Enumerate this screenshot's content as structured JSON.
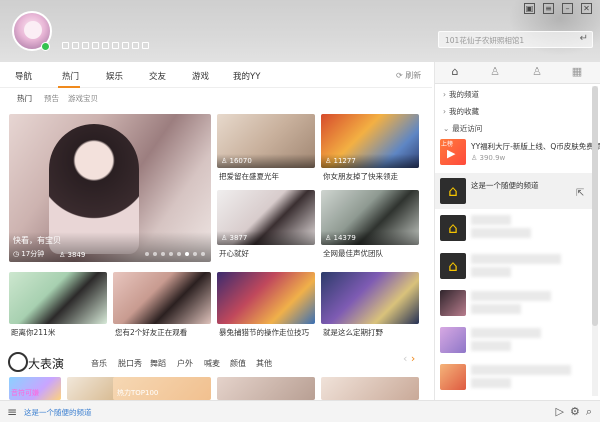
{
  "header": {
    "search_placeholder": "101花仙子农妍照相馆1",
    "window_controls": [
      "skin-icon",
      "list-icon",
      "minimize-icon",
      "close-icon"
    ],
    "badges": [
      "badge-1",
      "badge-2",
      "badge-3",
      "badge-4",
      "badge-5",
      "badge-6",
      "badge-7",
      "badge-8",
      "badge-9"
    ]
  },
  "nav": {
    "tabs": [
      "导航",
      "热门",
      "娱乐",
      "交友",
      "游戏",
      "我的YY"
    ],
    "active": "热门",
    "refresh": "刷新",
    "subtabs": [
      "热门",
      "预告",
      "游戏宝贝"
    ]
  },
  "featured": {
    "caption": "快看，有宝贝",
    "duration": "17分钟",
    "viewers": "3849"
  },
  "grid": [
    {
      "caption": "把爱留在盛夏光年",
      "count": "16070"
    },
    {
      "caption": "你女朋友掉了快来领走",
      "count": "11277"
    },
    {
      "caption": "开心就好",
      "count": "3877"
    },
    {
      "caption": "全网最佳声优团队",
      "count": "14379"
    },
    {
      "caption": "距离你211米",
      "count": ""
    },
    {
      "caption": "您有2个好友正在观看",
      "count": ""
    },
    {
      "caption": "暴兔捕猎节的操作走位技巧",
      "count": ""
    },
    {
      "caption": "就是这么定期打野",
      "count": ""
    }
  ],
  "section": {
    "title": "大表演",
    "tabs": [
      "音乐",
      "脱口秀",
      "舞蹈",
      "户外",
      "喊麦",
      "颜值",
      "其他"
    ],
    "thumb_texts": [
      "音符可嫌",
      "热力TOP100"
    ]
  },
  "bottom": {
    "text": "这是一个随便的频道"
  },
  "right_panel": {
    "tabs": [
      "home-icon",
      "user-icon",
      "friend-icon",
      "grid-icon"
    ],
    "rows": [
      "我的频道",
      "我的收藏",
      "最近访问"
    ],
    "recent": [
      {
        "title": "YY福利大厅-新版上线、Q币皮肤免费领",
        "sub": "390.9w"
      },
      {
        "title": "这是一个随便的频道",
        "sub": ""
      }
    ],
    "live_tag": "上榜"
  },
  "colors": {
    "accent": "#f08a1d",
    "link": "#3b7fd0",
    "online": "#35c24f"
  }
}
